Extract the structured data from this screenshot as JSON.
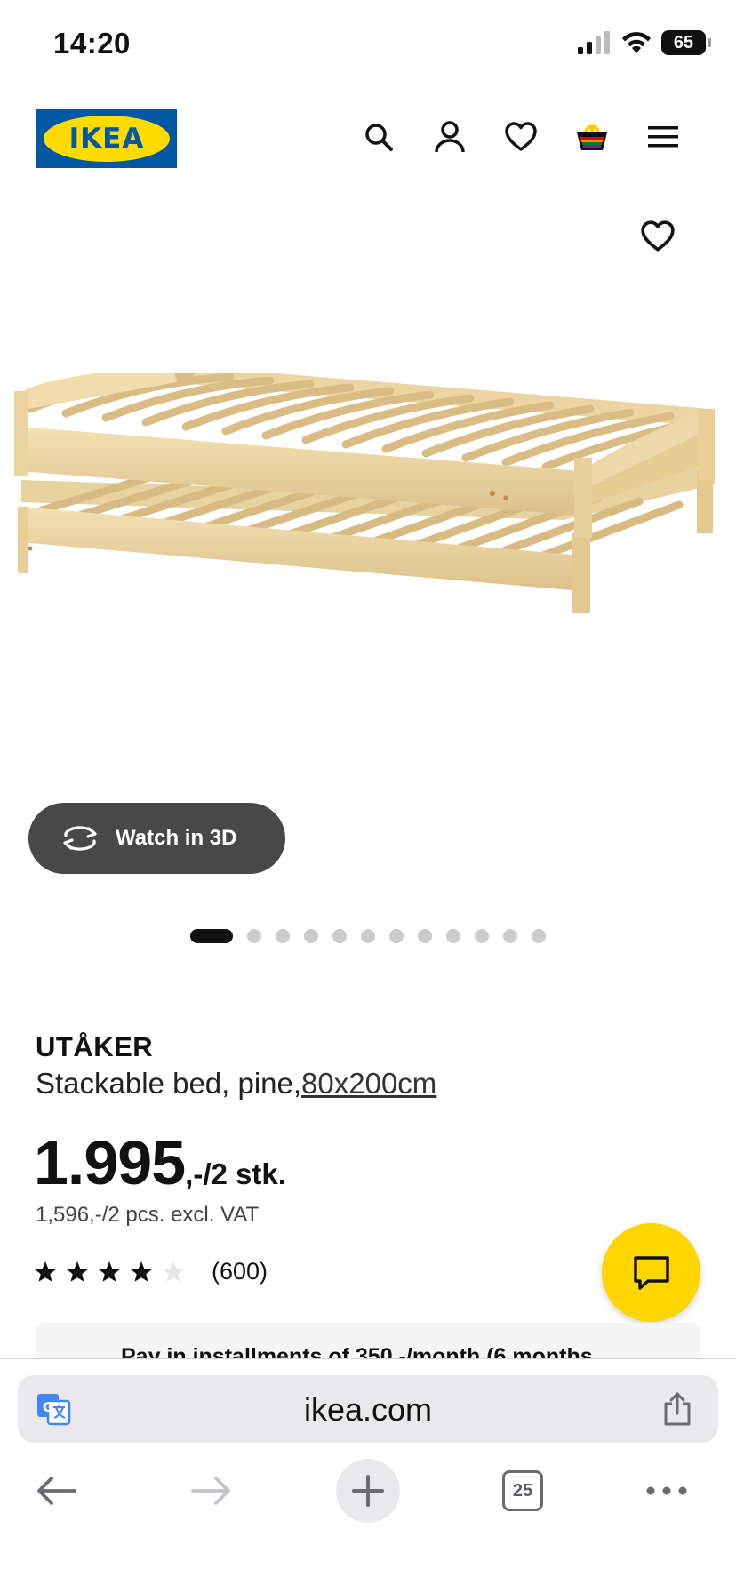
{
  "status_bar": {
    "time": "14:20",
    "battery": "65"
  },
  "header": {
    "logo_text": "IKEA",
    "icons": [
      "search-icon",
      "account-icon",
      "wishlist-icon",
      "cart-icon",
      "menu-icon"
    ]
  },
  "gallery": {
    "watch_3d_label": "Watch in 3D",
    "slide_count": 12,
    "active_slide": 1
  },
  "product": {
    "name": "UTÅKER",
    "description": "Stackable bed, pine,",
    "dimension_link": "80x200cm",
    "price_main": "1.995",
    "price_suffix": ",-/2 stk.",
    "price_excl_vat": "1,596,-/2 pcs. excl. VAT",
    "rating_stars": 4,
    "rating_max": 5,
    "rating_count": "(600)",
    "installment_text": "Pay in installments of 350,-/month (6 months"
  },
  "browser": {
    "url": "ikea.com",
    "tab_count": "25"
  },
  "colors": {
    "ikea_blue": "#0058a3",
    "ikea_yellow": "#ffdb00",
    "chat_yellow": "#ffd500",
    "watch_button_bg": "#484848"
  }
}
